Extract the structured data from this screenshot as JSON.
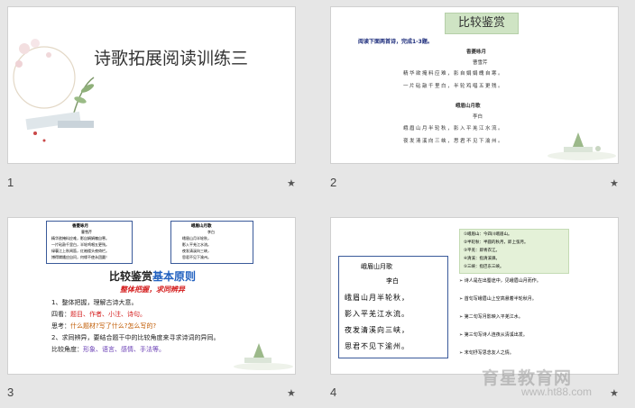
{
  "slides": [
    {
      "num": "1",
      "star": "★",
      "title": "诗歌拓展阅读训练三"
    },
    {
      "num": "2",
      "star": "★",
      "title": "比较鉴赏",
      "instruction": "阅读下面两首诗，完成1-3题。",
      "poem1": {
        "title": "香菱咏月",
        "author": "曹雪芹",
        "lines": [
          "精华欲掩料应难，影自娟娟魄自寒。",
          "一片砧敲千里白，半轮鸡唱五更残。"
        ]
      },
      "poem2": {
        "title": "峨眉山月歌",
        "author": "李白",
        "lines": [
          "峨眉山月半轮秋，影入平羌江水流。",
          "夜发清溪向三峡，思君不见下渝州。"
        ]
      }
    },
    {
      "num": "3",
      "star": "★",
      "box_left": {
        "title": "香菱咏月",
        "author": "曹雪芹",
        "lines": [
          "精华欲掩料应难，影自娟娟魄自寒。",
          "一片砧敲千里白，半轮鸡唱五更残。",
          "绿蓑江上秋闻笛，红袖楼头夜倚栏。",
          "博得嫦娥应自问，何缘不使永团圆！"
        ]
      },
      "box_right": {
        "title": "峨眉山月歌",
        "author": "李白",
        "lines": [
          "峨眉山月半轮秋，",
          "影入平羌江水流。",
          "夜发清溪向三峡，",
          "思君不见下渝州。"
        ]
      },
      "heading_a": "比较鉴赏",
      "heading_b": "基本原则",
      "subtitle": "整体把握，求同辨异",
      "p1": "1、整体把握，理解古诗大意。",
      "p2_a": "四看：",
      "p2_b": "题目、作者、小注、诗句。",
      "p3_a": "思考：",
      "p3_b": "什么题材?写了什么?怎么写的?",
      "p4": "2、求同辨异，要结合题干中的比较角度来寻求诗词的异同。",
      "p5_a": "比较角度：",
      "p5_b": "形象、语言、感情、手法等。"
    },
    {
      "num": "4",
      "star": "★",
      "poem_box": {
        "title": "峨眉山月歌",
        "author": "李白",
        "lines": [
          "峨眉山月半轮秋，",
          "影入平羌江水流。",
          "夜发清溪向三峡，",
          "思君不见下渝州。"
        ]
      },
      "notes": [
        "①峨眉山：今四川峨眉山。",
        "②半轮秋：半圆的秋月，即上弦月。",
        "③平羌：即青衣江。",
        "④清溪：指清溪驿。",
        "⑤三峡：指巴东三峡。"
      ],
      "bullets": [
        "诗人是在出蜀途中，见峨眉山月而作。",
        "首句写峨眉山上空高悬着半轮秋月。",
        "第二句写月影映入平羌江水。",
        "第三句写诗人连夜从清溪出发。",
        "末句抒写思念友人之情。"
      ]
    }
  ],
  "watermark": {
    "main": "育星教育网",
    "url": "www.ht88.com"
  }
}
